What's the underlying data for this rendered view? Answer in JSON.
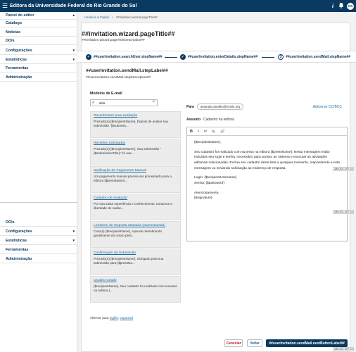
{
  "topbar": {
    "title": "Editora da Universidade Federal do Rio Grande do Sul",
    "help_icon": "i",
    "avatar_initials": "OS"
  },
  "sidebar": {
    "items": [
      {
        "label": "Painel do editor",
        "chevron": "▴"
      },
      {
        "label": "Catálogo"
      },
      {
        "label": "Notícias"
      },
      {
        "label": "DOIs"
      },
      {
        "label": "Configurações",
        "chevron": "▾"
      },
      {
        "label": "Estatísticas",
        "chevron": "▾"
      },
      {
        "label": "Ferramentas"
      },
      {
        "label": "Administração"
      }
    ],
    "items_lower": [
      {
        "label": "DOIs"
      },
      {
        "label": "Configurações",
        "chevron": "▾"
      },
      {
        "label": "Estatísticas",
        "chevron": "▾"
      },
      {
        "label": "Ferramentas"
      },
      {
        "label": "Administração"
      }
    ]
  },
  "breadcrumb": {
    "first": "Usuários & Papéis",
    "sep": "/",
    "second": "##invitation.wizard.pageTitle##"
  },
  "page": {
    "title": "##invitation.wizard.pageTitle##",
    "description": "##invitation.wizard.pageTitleDescription##"
  },
  "steps": [
    {
      "marker": "✓",
      "label": "##userInvitation.searchUser.stepName##"
    },
    {
      "marker": "✓",
      "label": "##userInvitation.enterDetails.stepName##"
    },
    {
      "marker": "3",
      "label": "##userInvitation.sendMail.stepName##"
    }
  ],
  "step": {
    "label": "##userInvitation.sendMail.stepLabel##",
    "description": "##userInvitation.sendMail.stepDescription##"
  },
  "templates": {
    "title": "Modelos de E-mail",
    "search_value": "sitio",
    "items": [
      {
        "title": "Ressubmeter para avaliação",
        "body": "Prezado(a) {$recipientName}, Depois de avaliar sua submissão \"{$submiss..."
      },
      {
        "title": "Revisões Solicitadas",
        "body": "Prezado(a) {$recipientName}, Sua submissão \"{$submissionTitle}\" foi ava..."
      },
      {
        "title": "Notificação de Pagamento Manual",
        "body": "Um pagamento manual precisa ser processado para a editora {$pressName}..."
      },
      {
        "title": "Cadastro de Avaliador",
        "body": "Por sua vasta experiência e conhecimento, tomamos a liberdade de cadas..."
      },
      {
        "title": "Lembrete de resposta atrasada (automatizada)",
        "body": "Caro(a) {$recipientName}, Apenas relembrando gentilmente do nosso pedi..."
      },
      {
        "title": "Confirmação da Submissão",
        "body": "Prezado(a) {$recipientName}, Obrigado pela sua submissão para {$pressNa..."
      },
      {
        "title": "Usuário Criado",
        "body": "{$recipientName}, Seu cadastro foi realizado com sucesso na editora {..."
      }
    ],
    "alternate_prefix": "Alternar para",
    "alt_lang_1": "inglês",
    "alt_sep": ",",
    "alt_lang_2": "espanhol"
  },
  "compose": {
    "to_label": "Para",
    "to_chip": "amanda.ramalho@scielo.org",
    "add_cc": "Adicionar CC/BCC",
    "subject_label": "Assunto",
    "subject_value": "Cadastro na editora",
    "toolbar": {
      "bold": "B",
      "italic": "I",
      "sup": "x²",
      "sub": "x₂",
      "link": "🔗"
    },
    "body": [
      "{$recipientName},",
      "Seu cadastro foi realizado com sucesso na editora {$pressName}. Nesta mensagem estão incluídos seu login e senha, necessário para acesso ao sistema e executar as atividades editoriais relacionadas. Exclua seu cadastro desta lista a qualquer momento, respondendo a esta mensagem ou enviando solicitação ao endereço de resposta.",
      "Login: {$recipientUsername}",
      "Senha: {$password}",
      "Atenciosamente,",
      "{$signature}"
    ]
  },
  "ip_tag": "189.201.207.14",
  "footer": {
    "cancel": "Cancelar",
    "back": "Voltar",
    "next": "##userInvitation.sendMail.nextButtonLabel##"
  }
}
